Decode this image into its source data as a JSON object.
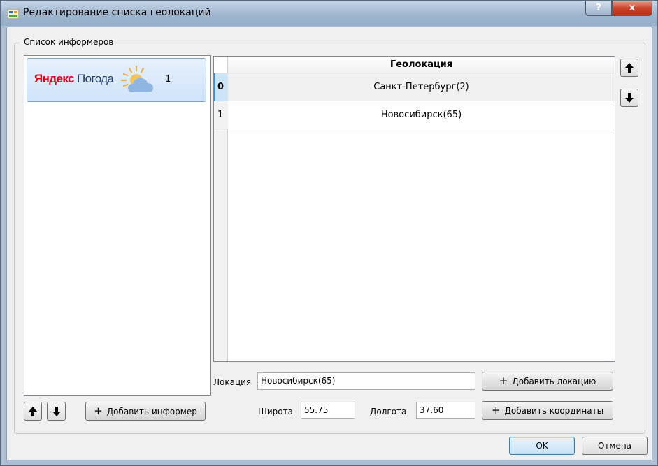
{
  "window": {
    "title": "Редактирование списка геолокаций",
    "help_label": "?",
    "close_label": "x"
  },
  "informers": {
    "group_label": "Список информеров",
    "items": [
      {
        "logo_part1": "Яндекс",
        "logo_part2": "Погода",
        "count": "1"
      }
    ],
    "add_label": "Добавить информер"
  },
  "geo_table": {
    "header": "Геолокация",
    "rows": [
      {
        "index": "0",
        "name": "Санкт-Петербург(2)"
      },
      {
        "index": "1",
        "name": "Новосибирск(65)"
      }
    ]
  },
  "location": {
    "label": "Локация",
    "value": "Новосибирск(65)",
    "add_label": "Добавить локацию"
  },
  "coords": {
    "lat_label": "Широта",
    "lat_value": "55.75",
    "lon_label": "Долгота",
    "lon_value": "37.60",
    "add_label": "Добавить координаты"
  },
  "dialog": {
    "ok_label": "OK",
    "cancel_label": "Отмена"
  },
  "icons": {
    "up": "arrow-up-icon",
    "down": "arrow-down-icon",
    "plus": "plus-icon"
  }
}
